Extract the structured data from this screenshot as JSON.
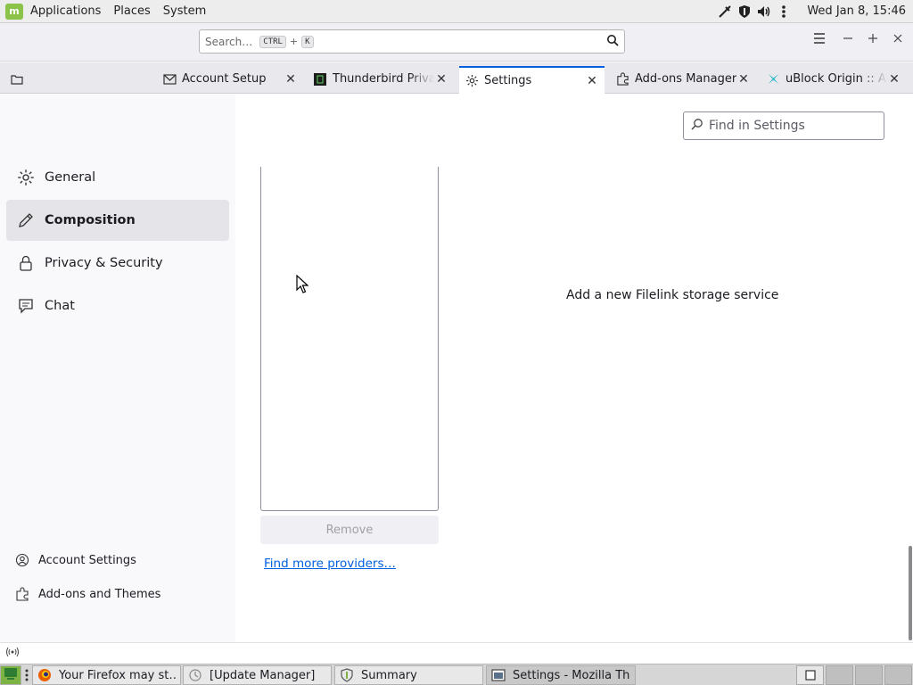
{
  "system_panel": {
    "menu": [
      "Applications",
      "Places",
      "System"
    ],
    "clock": "Wed Jan  8, 15:46",
    "logo_text": "m"
  },
  "toolbar": {
    "search_placeholder": "Search…",
    "shortcut_mod": "CTRL",
    "shortcut_plus": "+",
    "shortcut_key": "K"
  },
  "tabs": [
    {
      "label": "Account Setup",
      "icon": "envelope-icon"
    },
    {
      "label": "Thunderbird Privacy Notice",
      "icon": "thunderbird-icon"
    },
    {
      "label": "Settings",
      "icon": "gear-icon",
      "selected": true
    },
    {
      "label": "Add-ons Manager",
      "icon": "puzzle-icon"
    },
    {
      "label": "uBlock Origin :: Add-ons",
      "icon": "ublock-icon"
    }
  ],
  "sidebar": {
    "categories": [
      {
        "label": "General",
        "icon": "gear-icon"
      },
      {
        "label": "Composition",
        "icon": "pencil-icon",
        "selected": true
      },
      {
        "label": "Privacy & Security",
        "icon": "lock-icon"
      },
      {
        "label": "Chat",
        "icon": "chat-icon"
      }
    ],
    "footer": [
      {
        "label": "Account Settings",
        "icon": "account-icon"
      },
      {
        "label": "Add-ons and Themes",
        "icon": "puzzle-icon"
      }
    ]
  },
  "main": {
    "find_placeholder": "Find in Settings",
    "remove_label": "Remove",
    "find_more_label": "Find more providers…",
    "filelink_message": "Add a new Filelink storage service"
  },
  "taskbar": {
    "tasks": [
      {
        "label": "Your Firefox may st…",
        "icon": "firefox-icon"
      },
      {
        "label": "[Update Manager]",
        "icon": "update-icon"
      },
      {
        "label": "Summary",
        "icon": "shield-icon"
      },
      {
        "label": "Settings - Mozilla Th…",
        "icon": "window-icon",
        "active": true
      }
    ]
  },
  "colors": {
    "accent": "#0060df",
    "link": "#0061e0",
    "mint_green": "#8bc34a"
  }
}
